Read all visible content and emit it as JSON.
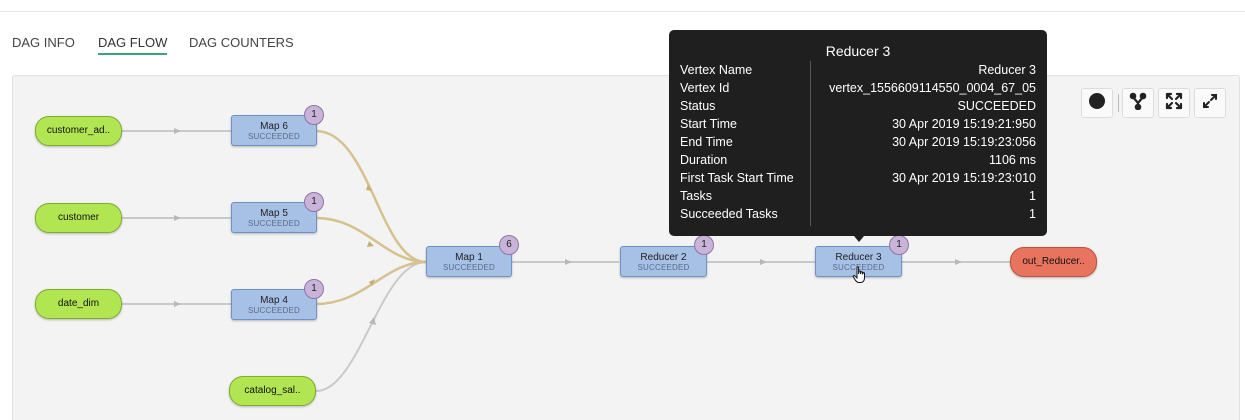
{
  "tabs": [
    {
      "label": "DAG INFO",
      "active": false
    },
    {
      "label": "DAG FLOW",
      "active": true
    },
    {
      "label": "DAG COUNTERS",
      "active": false
    }
  ],
  "inputs": [
    {
      "label": "customer_ad.."
    },
    {
      "label": "customer"
    },
    {
      "label": "date_dim"
    },
    {
      "label": "catalog_sal.."
    }
  ],
  "vertices": [
    {
      "name": "Map 6",
      "status": "SUCCEEDED",
      "badge": "1"
    },
    {
      "name": "Map 5",
      "status": "SUCCEEDED",
      "badge": "1"
    },
    {
      "name": "Map 4",
      "status": "SUCCEEDED",
      "badge": "1"
    },
    {
      "name": "Map 1",
      "status": "SUCCEEDED",
      "badge": "6"
    },
    {
      "name": "Reducer 2",
      "status": "SUCCEEDED",
      "badge": "1"
    },
    {
      "name": "Reducer 3",
      "status": "SUCCEEDED",
      "badge": "1"
    }
  ],
  "output": {
    "label": "out_Reducer.."
  },
  "toolbar": {
    "icons": [
      "circle-icon",
      "branch-icon",
      "fit-icon",
      "fullscreen-icon"
    ]
  },
  "tooltip": {
    "title": "Reducer 3",
    "rows": [
      {
        "key": "Vertex Name",
        "value": "Reducer 3"
      },
      {
        "key": "Vertex Id",
        "value": "vertex_1556609114550_0004_67_05"
      },
      {
        "key": "Status",
        "value": "SUCCEEDED"
      },
      {
        "key": "Start Time",
        "value": "30 Apr 2019 15:19:21:950"
      },
      {
        "key": "End Time",
        "value": "30 Apr 2019 15:19:23:056"
      },
      {
        "key": "Duration",
        "value": "1106 ms"
      },
      {
        "key": "First Task Start Time",
        "value": "30 Apr 2019 15:19:23:010"
      },
      {
        "key": "Tasks",
        "value": "1"
      },
      {
        "key": "Succeeded Tasks",
        "value": "1"
      }
    ]
  },
  "colors": {
    "input_node": "#b2e552",
    "output_node": "#e8735f",
    "vertex": "#a7c0e6",
    "badge": "#c9b3d9",
    "link_gray": "#c9c9c9",
    "link_tan": "#d7c18f",
    "tab_underline": "#3fa37a",
    "tooltip_bg": "#1f1f1f"
  }
}
